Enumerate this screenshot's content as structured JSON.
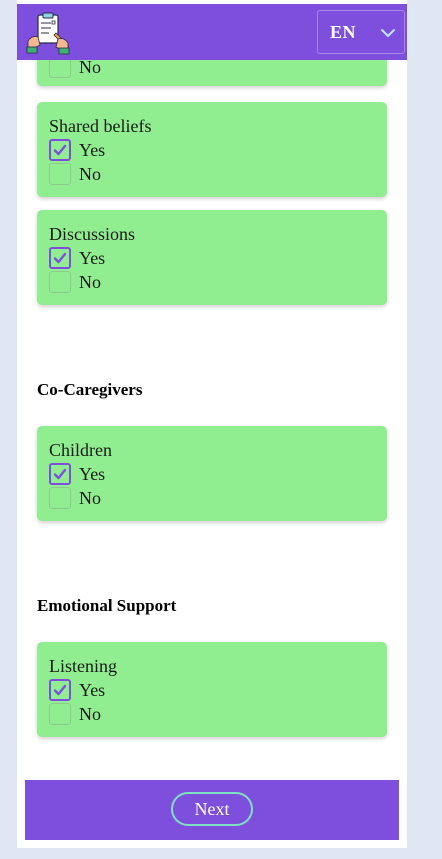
{
  "header": {
    "language": "EN"
  },
  "cards": [
    {
      "label": "",
      "options": [
        {
          "label": "No",
          "checked": false
        }
      ]
    },
    {
      "label": "Shared beliefs",
      "options": [
        {
          "label": "Yes",
          "checked": true
        },
        {
          "label": "No",
          "checked": false
        }
      ]
    },
    {
      "label": "Discussions",
      "options": [
        {
          "label": "Yes",
          "checked": true
        },
        {
          "label": "No",
          "checked": false
        }
      ]
    },
    {
      "label": "Children",
      "options": [
        {
          "label": "Yes",
          "checked": true
        },
        {
          "label": "No",
          "checked": false
        }
      ]
    },
    {
      "label": "Listening",
      "options": [
        {
          "label": "Yes",
          "checked": true
        },
        {
          "label": "No",
          "checked": false
        }
      ]
    }
  ],
  "sections": {
    "co_caregivers": "Co-Caregivers",
    "emotional_support": "Emotional Support"
  },
  "footer": {
    "next_label": "Next"
  },
  "colors": {
    "accent": "#7d4fdc",
    "card": "#90ee90",
    "button_border": "#7ee0c0"
  }
}
